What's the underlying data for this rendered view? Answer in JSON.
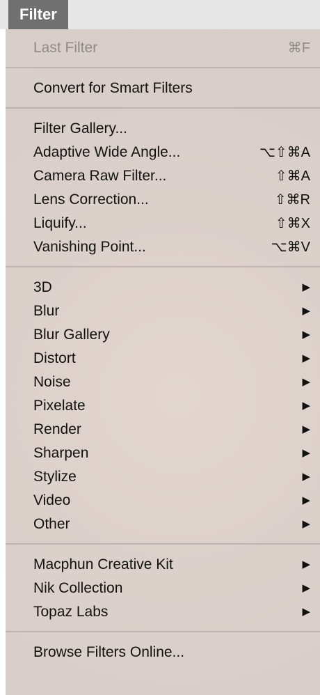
{
  "menubar": {
    "title": "Filter"
  },
  "menu": {
    "last_filter": {
      "label": "Last Filter",
      "shortcut": "⌘F"
    },
    "convert": {
      "label": "Convert for Smart Filters"
    },
    "gallery_group": [
      {
        "label": "Filter Gallery...",
        "shortcut": ""
      },
      {
        "label": "Adaptive Wide Angle...",
        "shortcut": "⌥⇧⌘A"
      },
      {
        "label": "Camera Raw Filter...",
        "shortcut": "⇧⌘A"
      },
      {
        "label": "Lens Correction...",
        "shortcut": "⇧⌘R"
      },
      {
        "label": "Liquify...",
        "shortcut": "⇧⌘X"
      },
      {
        "label": "Vanishing Point...",
        "shortcut": "⌥⌘V"
      }
    ],
    "submenus": [
      "3D",
      "Blur",
      "Blur Gallery",
      "Distort",
      "Noise",
      "Pixelate",
      "Render",
      "Sharpen",
      "Stylize",
      "Video",
      "Other"
    ],
    "plugins": [
      "Macphun Creative Kit",
      "Nik Collection",
      "Topaz Labs"
    ],
    "browse": {
      "label": "Browse Filters Online..."
    },
    "submenu_arrow": "▶"
  }
}
